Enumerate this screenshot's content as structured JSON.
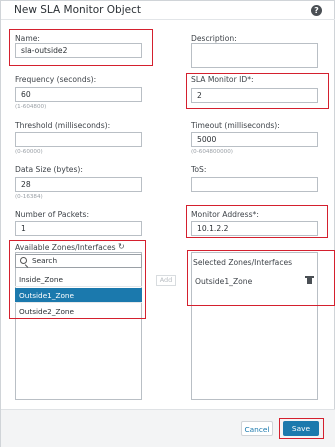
{
  "dialog": {
    "title": "New SLA Monitor Object",
    "help_icon": "help-icon",
    "help_glyph": "?"
  },
  "form": {
    "name": {
      "label": "Name:",
      "value": "sla-outside2"
    },
    "description": {
      "label": "Description:",
      "value": ""
    },
    "frequency": {
      "label": "Frequency (seconds):",
      "value": "60",
      "hint": "(1-604800)"
    },
    "sla_monitor_id": {
      "label": "SLA Monitor ID*:",
      "value": "2"
    },
    "threshold": {
      "label": "Threshold (milliseconds):",
      "value": "",
      "hint": "(0-60000)"
    },
    "timeout": {
      "label": "Timeout (milliseconds):",
      "value": "5000",
      "hint": "(0-604800000)"
    },
    "data_size": {
      "label": "Data Size (bytes):",
      "value": "28",
      "hint": "(0-16384)"
    },
    "tos": {
      "label": "ToS:",
      "value": ""
    },
    "packets": {
      "label": "Number of Packets:",
      "value": "1"
    },
    "monitor_address": {
      "label": "Monitor Address*:",
      "value": "10.1.2.2"
    }
  },
  "zones": {
    "available_label": "Available Zones/Interfaces",
    "refresh_icon": "refresh-icon",
    "refresh_glyph": "↻",
    "search_placeholder": "Search",
    "available": [
      "Inside_Zone",
      "Outside1_Zone",
      "Outside2_Zone"
    ],
    "selected_index": 1,
    "add_label": "Add",
    "selected_label": "Selected Zones/Interfaces",
    "selected": [
      "Outside1_Zone"
    ],
    "delete_icon": "trash-icon"
  },
  "footer": {
    "cancel_label": "Cancel",
    "save_label": "Save"
  },
  "colors": {
    "accent": "#1b79ad",
    "highlight_border": "#d4202e"
  }
}
